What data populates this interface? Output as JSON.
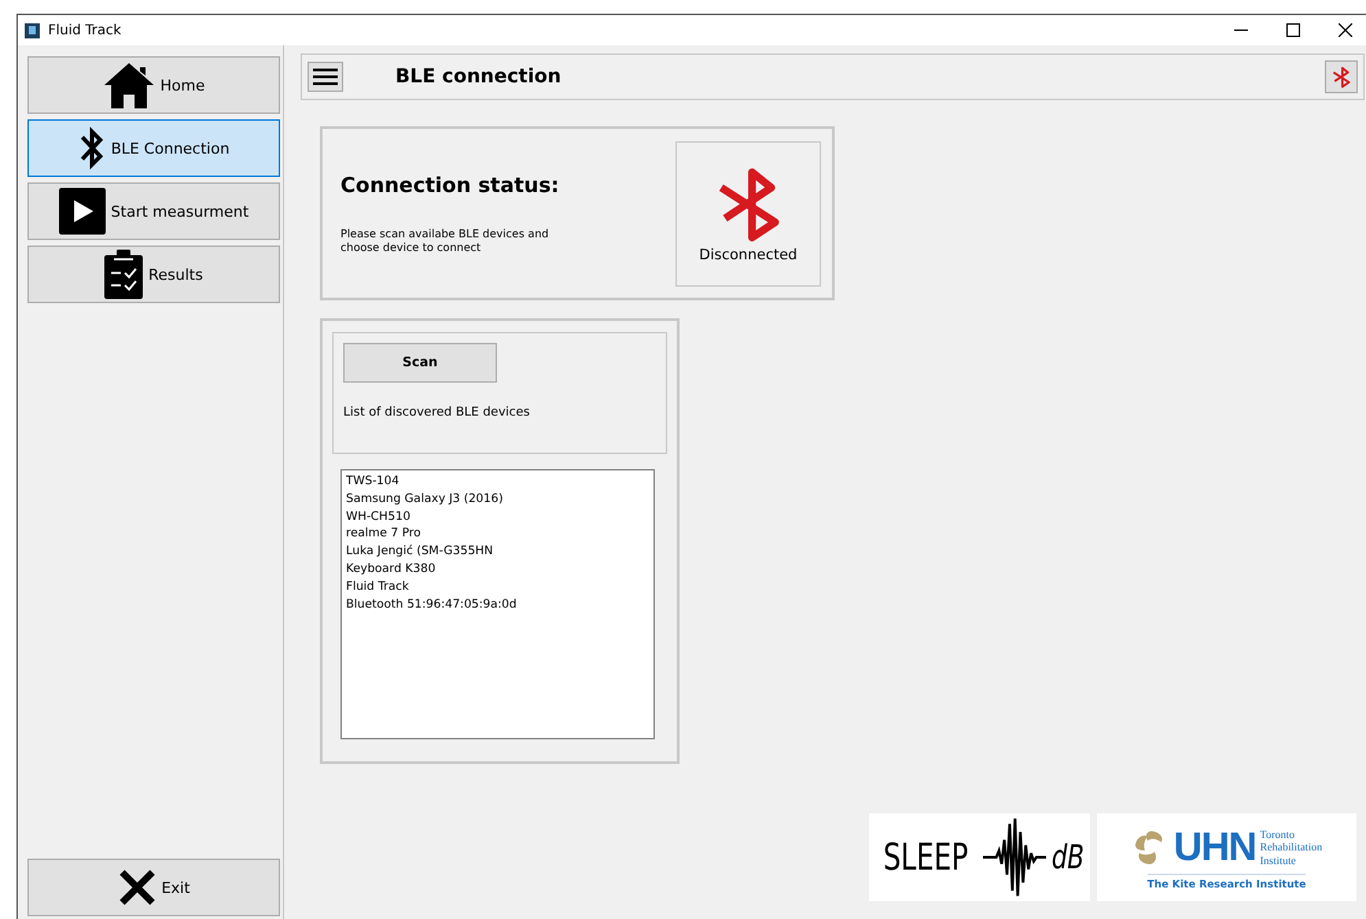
{
  "window": {
    "title": "Fluid Track"
  },
  "sidebar": {
    "items": [
      {
        "kind": "home",
        "label": "Home",
        "selected": false
      },
      {
        "kind": "bluetooth",
        "label": "BLE Connection",
        "selected": true
      },
      {
        "kind": "play",
        "label": "Start measurment",
        "selected": false
      },
      {
        "kind": "results",
        "label": "Results",
        "selected": false
      }
    ],
    "exit": {
      "label": "Exit"
    }
  },
  "header": {
    "title": "BLE connection"
  },
  "connection": {
    "heading": "Connection status:",
    "hint": "Please scan availabe BLE devices and\nchoose device to connect",
    "status": "Disconnected",
    "connected": false
  },
  "scan": {
    "button": "Scan",
    "caption": "List of discovered BLE devices",
    "devices": [
      "TWS-104",
      "Samsung Galaxy J3 (2016)",
      "WH-CH510",
      "realme 7 Pro",
      "Luka Jengić (SM-G355HN",
      "Keyboard K380",
      "Fluid Track",
      "Bluetooth 51:96:47:05:9a:0d"
    ]
  },
  "logos": {
    "sleep": {
      "left": "SLEEP",
      "right": "dB"
    },
    "uhn": {
      "mark": "UHN",
      "name": "Toronto\nRehabilitation\nInstitute",
      "tagline": "The Kite Research Institute"
    }
  }
}
